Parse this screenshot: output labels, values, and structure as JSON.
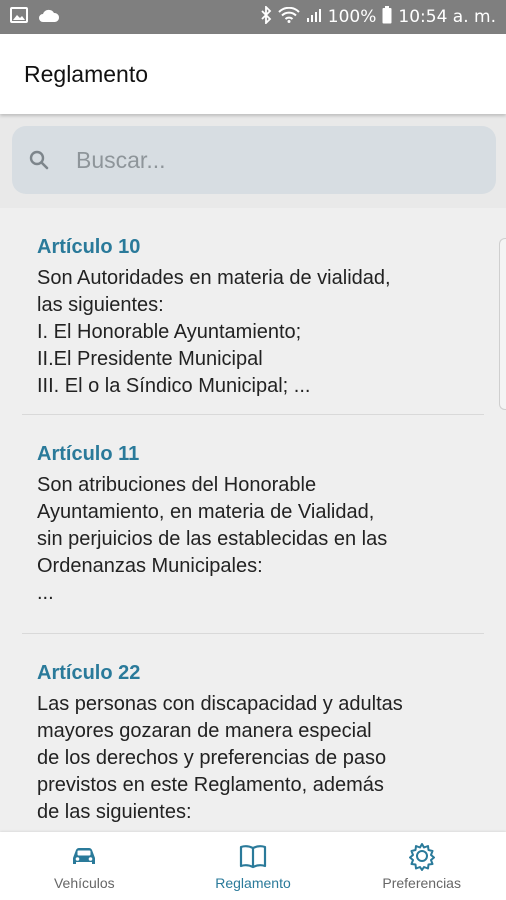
{
  "status_bar": {
    "battery": "100%",
    "time": "10:54 a. m."
  },
  "app_bar": {
    "title": "Reglamento"
  },
  "search": {
    "placeholder": "Buscar..."
  },
  "articles": [
    {
      "title": "Artículo 10",
      "body": "Son Autoridades en materia de vialidad,\nlas siguientes:\nI. El Honorable Ayuntamiento;\nII.El Presidente Municipal\nIII. El o la Síndico Municipal; ..."
    },
    {
      "title": "Artículo 11",
      "body": "Son atribuciones del Honorable\nAyuntamiento, en materia de Vialidad,\nsin perjuicios de las establecidas en las\nOrdenanzas Municipales:\n ..."
    },
    {
      "title": "Artículo 22",
      "body": "Las personas con discapacidad y adultas\nmayores gozaran de manera especial\nde los derechos y preferencias de paso\nprevistos en este Reglamento, además\nde las siguientes:"
    }
  ],
  "bottom_nav": {
    "items": [
      {
        "label": "Vehículos",
        "icon": "car-icon"
      },
      {
        "label": "Reglamento",
        "icon": "book-icon"
      },
      {
        "label": "Preferencias",
        "icon": "gear-icon"
      }
    ],
    "active_index": 1
  },
  "colors": {
    "accent": "#2a7a9a",
    "status_bar": "#7f7f7f",
    "search_bg": "#d7dde2"
  }
}
